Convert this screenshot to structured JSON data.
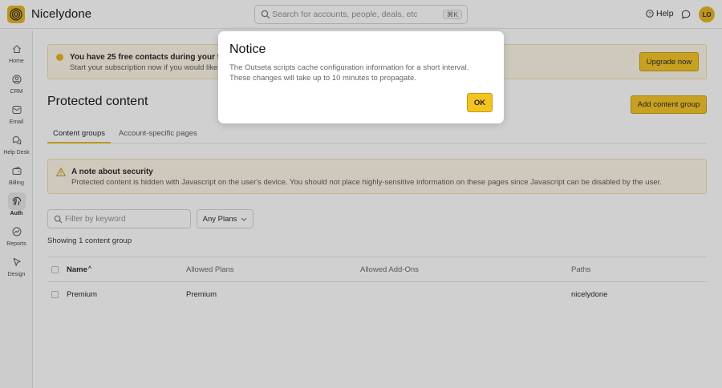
{
  "app": {
    "name": "Nicelydone",
    "logo_icon": "spiral-logo-icon",
    "brand_color": "#e7b41c"
  },
  "header": {
    "search_placeholder": "Search for accounts, people, deals, etc",
    "search_shortcut": "⌘K",
    "help_label": "Help",
    "avatar_initials": "LO"
  },
  "sidebar": {
    "items": [
      {
        "label": "Home",
        "icon": "home-icon"
      },
      {
        "label": "CRM",
        "icon": "crm-icon"
      },
      {
        "label": "Email",
        "icon": "email-icon"
      },
      {
        "label": "Help Desk",
        "icon": "help-desk-icon"
      },
      {
        "label": "Billing",
        "icon": "billing-icon"
      },
      {
        "label": "Auth",
        "icon": "auth-icon",
        "active": true
      },
      {
        "label": "Reports",
        "icon": "reports-icon"
      },
      {
        "label": "Design",
        "icon": "design-icon"
      }
    ]
  },
  "trial_banner": {
    "title": "You have 25 free contacts during your free trial",
    "subtitle": "Start your subscription now if you would like to i",
    "button_label": "Upgrade now"
  },
  "page": {
    "title": "Protected content",
    "add_button_label": "Add content group",
    "tabs": [
      {
        "label": "Content groups",
        "active": true
      },
      {
        "label": "Account-specific pages"
      }
    ]
  },
  "security_note": {
    "title": "A note about security",
    "body": "Protected content is hidden with Javascript on the user's device. You should not place highly-sensitive information on these pages since Javascript can be disabled by the user."
  },
  "filters": {
    "keyword_placeholder": "Filter by keyword",
    "plans_label": "Any Plans",
    "showing_text": "Showing 1 content group"
  },
  "table": {
    "headers": {
      "name": "Name",
      "sort_indicator": "^",
      "plans": "Allowed Plans",
      "addons": "Allowed Add-Ons",
      "paths": "Paths"
    },
    "rows": [
      {
        "name": "Premium",
        "plans": "Premium",
        "addons": "",
        "paths": "nicelydone"
      }
    ]
  },
  "modal": {
    "title": "Notice",
    "body": "The Outseta scripts cache configuration information for a short interval. These changes will take up to 10 minutes to propagate.",
    "ok_label": "OK"
  }
}
